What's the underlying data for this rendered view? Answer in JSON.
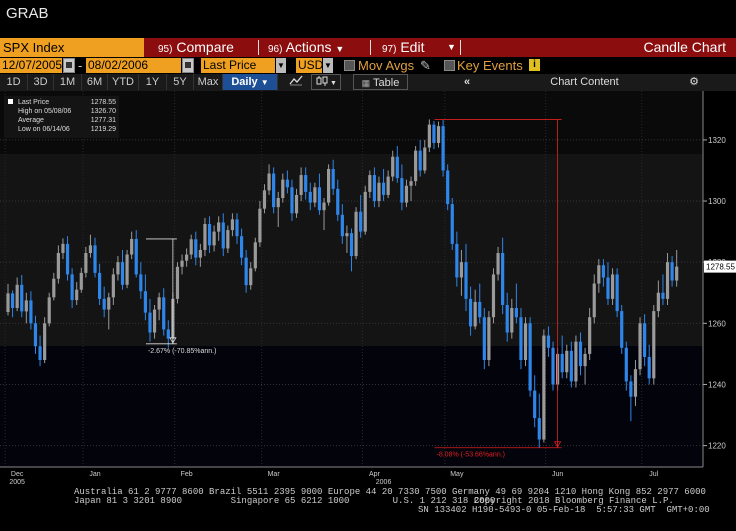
{
  "window": {
    "title": "GRAB"
  },
  "command_bar": {
    "security": "SPX Index",
    "compare": {
      "num": "95)",
      "label": "Compare"
    },
    "actions": {
      "num": "96)",
      "label": "Actions"
    },
    "edit": {
      "num": "97)",
      "label": "Edit"
    },
    "chart_type": "Candle Chart"
  },
  "toolbar": {
    "start_date": "12/07/2005",
    "end_date": "08/02/2006",
    "field": "Last Price",
    "currency": "USD",
    "mov_avgs": "Mov Avgs",
    "key_events": "Key Events",
    "info": "i"
  },
  "period_buttons": [
    "1D",
    "3D",
    "1M",
    "6M",
    "YTD",
    "1Y",
    "5Y",
    "Max"
  ],
  "frequency": "Daily",
  "table_label": "Table",
  "chart_content_label": "Chart Content",
  "legend": {
    "rows": [
      {
        "label": "Last Price",
        "value": "1278.55"
      },
      {
        "label": "High on 05/08/06",
        "value": "1326.70"
      },
      {
        "label": "Average",
        "value": "1277.31"
      },
      {
        "label": "Low on 06/14/06",
        "value": "1219.29"
      }
    ]
  },
  "colors": {
    "up": "#9a9a9a",
    "down": "#2f86ea",
    "accent": "#f0a020",
    "command": "#8b0d0d"
  },
  "chart_data": {
    "type": "candlestick",
    "ylim": [
      1213,
      1336
    ],
    "yticks": [
      1220,
      1240,
      1260,
      1280,
      1300,
      1320
    ],
    "x_month_labels": [
      {
        "label": "Dec",
        "index": 2
      },
      {
        "label": "Jan",
        "index": 19
      },
      {
        "label": "Feb",
        "index": 39
      },
      {
        "label": "Mar",
        "index": 58
      },
      {
        "label": "Apr",
        "index": 80
      },
      {
        "label": "May",
        "index": 98
      },
      {
        "label": "Jun",
        "index": 120
      },
      {
        "label": "Jul",
        "index": 141
      }
    ],
    "x_year_labels": [
      {
        "label": "2005",
        "index": 2
      },
      {
        "label": "2006",
        "index": 82
      }
    ],
    "last_price_label": "1278.55",
    "annotations": [
      {
        "text": "-2.67% (-70.85%ann.)",
        "start_index": 31,
        "end_index": 36,
        "start_value": 1287.6,
        "end_value": 1253.3,
        "color": "#ddd"
      },
      {
        "text": "-8.08% (-53.66%ann.)",
        "start_index": 94,
        "end_index": 120,
        "start_value": 1326.7,
        "end_value": 1219.3,
        "color": "#e02020"
      }
    ],
    "ohlc": [
      [
        1263.7,
        1272.9,
        1262.6,
        1269.8
      ],
      [
        1269.8,
        1270.8,
        1262.0,
        1265.0
      ],
      [
        1265.0,
        1275.0,
        1264.0,
        1272.6
      ],
      [
        1272.6,
        1275.8,
        1262.0,
        1263.9
      ],
      [
        1263.9,
        1270.0,
        1260.0,
        1267.5
      ],
      [
        1267.5,
        1270.5,
        1258.0,
        1260.0
      ],
      [
        1260.0,
        1262.5,
        1250.0,
        1252.5
      ],
      [
        1252.5,
        1256.0,
        1246.0,
        1248.0
      ],
      [
        1248.0,
        1262.0,
        1247.0,
        1260.0
      ],
      [
        1260.0,
        1270.0,
        1259.0,
        1268.5
      ],
      [
        1268.5,
        1276.5,
        1267.5,
        1274.6
      ],
      [
        1274.6,
        1285.5,
        1273.0,
        1283.0
      ],
      [
        1283.0,
        1287.8,
        1281.0,
        1286.0
      ],
      [
        1286.0,
        1288.5,
        1274.0,
        1276.0
      ],
      [
        1276.0,
        1278.0,
        1265.0,
        1267.6
      ],
      [
        1267.6,
        1273.5,
        1266.0,
        1271.0
      ],
      [
        1271.0,
        1278.2,
        1270.0,
        1276.5
      ],
      [
        1276.5,
        1285.0,
        1275.0,
        1283.0
      ],
      [
        1283.0,
        1289.0,
        1281.5,
        1285.5
      ],
      [
        1285.5,
        1288.0,
        1275.0,
        1276.5
      ],
      [
        1276.5,
        1279.5,
        1266.0,
        1268.0
      ],
      [
        1268.0,
        1272.0,
        1262.0,
        1264.5
      ],
      [
        1264.5,
        1270.0,
        1258.0,
        1268.5
      ],
      [
        1268.5,
        1278.0,
        1266.0,
        1276.0
      ],
      [
        1276.0,
        1282.0,
        1274.0,
        1280.0
      ],
      [
        1280.0,
        1284.0,
        1271.0,
        1272.6
      ],
      [
        1272.6,
        1284.0,
        1271.5,
        1282.5
      ],
      [
        1282.5,
        1290.0,
        1281.0,
        1287.6
      ],
      [
        1287.6,
        1290.5,
        1275.0,
        1276.0
      ],
      [
        1276.0,
        1280.0,
        1268.0,
        1270.5
      ],
      [
        1270.5,
        1276.0,
        1261.0,
        1263.5
      ],
      [
        1263.5,
        1268.0,
        1254.0,
        1257.0
      ],
      [
        1257.0,
        1266.0,
        1255.0,
        1264.5
      ],
      [
        1264.5,
        1270.0,
        1261.0,
        1268.5
      ],
      [
        1268.5,
        1271.5,
        1256.0,
        1258.0
      ],
      [
        1258.0,
        1261.0,
        1252.0,
        1255.0
      ],
      [
        1255.0,
        1270.0,
        1253.5,
        1268.0
      ],
      [
        1268.0,
        1280.0,
        1266.5,
        1278.5
      ],
      [
        1278.5,
        1282.5,
        1276.0,
        1280.5
      ],
      [
        1280.5,
        1284.5,
        1278.5,
        1282.5
      ],
      [
        1282.5,
        1289.0,
        1281.0,
        1287.5
      ],
      [
        1287.5,
        1290.0,
        1279.0,
        1281.5
      ],
      [
        1281.5,
        1286.0,
        1278.5,
        1284.0
      ],
      [
        1284.0,
        1294.5,
        1282.0,
        1292.5
      ],
      [
        1292.5,
        1295.0,
        1283.0,
        1285.5
      ],
      [
        1285.5,
        1292.0,
        1283.5,
        1290.0
      ],
      [
        1290.0,
        1295.0,
        1287.0,
        1293.0
      ],
      [
        1293.0,
        1296.0,
        1282.0,
        1284.5
      ],
      [
        1284.5,
        1292.0,
        1283.0,
        1290.5
      ],
      [
        1290.5,
        1296.0,
        1288.5,
        1294.0
      ],
      [
        1294.0,
        1296.0,
        1286.0,
        1288.5
      ],
      [
        1288.5,
        1291.0,
        1279.0,
        1281.5
      ],
      [
        1281.5,
        1284.0,
        1270.0,
        1272.5
      ],
      [
        1272.5,
        1280.0,
        1271.0,
        1278.0
      ],
      [
        1278.0,
        1288.0,
        1277.0,
        1286.5
      ],
      [
        1286.5,
        1300.0,
        1285.0,
        1297.5
      ],
      [
        1297.5,
        1305.5,
        1296.0,
        1303.5
      ],
      [
        1303.5,
        1312.0,
        1302.0,
        1309.0
      ],
      [
        1309.0,
        1311.0,
        1296.0,
        1298.0
      ],
      [
        1298.0,
        1303.0,
        1291.5,
        1301.0
      ],
      [
        1301.0,
        1309.0,
        1299.5,
        1307.0
      ],
      [
        1307.0,
        1310.0,
        1302.5,
        1304.5
      ],
      [
        1304.5,
        1307.0,
        1293.5,
        1296.0
      ],
      [
        1296.0,
        1304.0,
        1294.5,
        1302.0
      ],
      [
        1302.0,
        1311.0,
        1300.0,
        1308.5
      ],
      [
        1308.5,
        1311.0,
        1300.5,
        1303.0
      ],
      [
        1303.0,
        1306.0,
        1297.0,
        1299.5
      ],
      [
        1299.5,
        1306.0,
        1298.0,
        1304.5
      ],
      [
        1304.5,
        1309.0,
        1295.5,
        1297.0
      ],
      [
        1297.0,
        1301.0,
        1290.5,
        1299.5
      ],
      [
        1299.5,
        1312.0,
        1298.5,
        1310.5
      ],
      [
        1310.5,
        1313.5,
        1302.0,
        1304.0
      ],
      [
        1304.0,
        1307.0,
        1293.5,
        1295.5
      ],
      [
        1295.5,
        1299.0,
        1286.0,
        1288.5
      ],
      [
        1288.5,
        1292.0,
        1283.0,
        1289.5
      ],
      [
        1289.5,
        1291.0,
        1277.0,
        1282.0
      ],
      [
        1282.0,
        1298.0,
        1281.0,
        1296.5
      ],
      [
        1296.5,
        1302.0,
        1288.0,
        1290.0
      ],
      [
        1290.0,
        1305.0,
        1289.0,
        1303.0
      ],
      [
        1303.0,
        1310.0,
        1301.0,
        1308.5
      ],
      [
        1308.5,
        1311.0,
        1298.0,
        1300.0
      ],
      [
        1300.0,
        1308.0,
        1298.0,
        1306.0
      ],
      [
        1306.0,
        1310.5,
        1300.0,
        1302.0
      ],
      [
        1302.0,
        1310.0,
        1301.0,
        1308.0
      ],
      [
        1308.0,
        1316.5,
        1306.5,
        1314.5
      ],
      [
        1314.5,
        1318.0,
        1306.0,
        1307.5
      ],
      [
        1307.5,
        1312.0,
        1297.0,
        1299.5
      ],
      [
        1299.5,
        1307.0,
        1298.0,
        1305.0
      ],
      [
        1305.0,
        1308.0,
        1300.0,
        1306.5
      ],
      [
        1306.5,
        1318.0,
        1305.0,
        1316.5
      ],
      [
        1316.5,
        1320.0,
        1308.0,
        1310.0
      ],
      [
        1310.0,
        1320.0,
        1309.0,
        1317.5
      ],
      [
        1317.5,
        1326.7,
        1316.0,
        1325.0
      ],
      [
        1325.0,
        1326.2,
        1317.0,
        1319.0
      ],
      [
        1319.0,
        1326.0,
        1317.5,
        1324.5
      ],
      [
        1324.5,
        1326.5,
        1308.0,
        1310.0
      ],
      [
        1310.0,
        1312.0,
        1297.0,
        1299.0
      ],
      [
        1299.0,
        1301.0,
        1284.0,
        1286.0
      ],
      [
        1286.0,
        1290.0,
        1272.0,
        1275.0
      ],
      [
        1275.0,
        1284.0,
        1269.0,
        1280.0
      ],
      [
        1280.0,
        1286.0,
        1264.0,
        1268.0
      ],
      [
        1268.0,
        1272.0,
        1256.0,
        1259.0
      ],
      [
        1259.0,
        1271.0,
        1258.0,
        1267.0
      ],
      [
        1267.0,
        1273.0,
        1260.0,
        1262.0
      ],
      [
        1262.0,
        1265.0,
        1245.0,
        1248.0
      ],
      [
        1248.0,
        1264.0,
        1246.0,
        1262.0
      ],
      [
        1262.0,
        1278.0,
        1260.0,
        1276.0
      ],
      [
        1276.0,
        1285.0,
        1274.0,
        1283.0
      ],
      [
        1283.0,
        1288.0,
        1263.0,
        1266.0
      ],
      [
        1266.0,
        1270.0,
        1254.0,
        1257.0
      ],
      [
        1257.0,
        1268.0,
        1255.0,
        1265.0
      ],
      [
        1265.0,
        1273.0,
        1260.0,
        1262.0
      ],
      [
        1262.0,
        1265.0,
        1245.0,
        1248.0
      ],
      [
        1248.0,
        1262.0,
        1246.0,
        1260.0
      ],
      [
        1260.0,
        1262.0,
        1236.0,
        1238.0
      ],
      [
        1238.0,
        1243.0,
        1226.0,
        1229.0
      ],
      [
        1229.0,
        1237.0,
        1219.3,
        1222.0
      ],
      [
        1222.0,
        1258.0,
        1221.0,
        1256.0
      ],
      [
        1256.0,
        1259.0,
        1249.0,
        1252.0
      ],
      [
        1252.0,
        1254.0,
        1238.0,
        1240.0
      ],
      [
        1240.0,
        1252.0,
        1238.0,
        1250.0
      ],
      [
        1250.0,
        1256.0,
        1242.0,
        1244.0
      ],
      [
        1244.0,
        1253.0,
        1242.0,
        1251.0
      ],
      [
        1251.0,
        1254.0,
        1239.0,
        1241.0
      ],
      [
        1241.0,
        1256.0,
        1239.0,
        1254.0
      ],
      [
        1254.0,
        1257.0,
        1243.0,
        1246.0
      ],
      [
        1246.0,
        1252.0,
        1240.0,
        1250.0
      ],
      [
        1250.0,
        1265.0,
        1248.0,
        1262.0
      ],
      [
        1262.0,
        1276.0,
        1260.0,
        1273.0
      ],
      [
        1273.0,
        1281.0,
        1270.0,
        1279.0
      ],
      [
        1279.0,
        1281.0,
        1272.0,
        1275.0
      ],
      [
        1275.0,
        1280.0,
        1266.0,
        1268.0
      ],
      [
        1268.0,
        1278.0,
        1266.0,
        1276.0
      ],
      [
        1276.0,
        1278.0,
        1262.0,
        1264.0
      ],
      [
        1264.0,
        1266.0,
        1250.0,
        1252.0
      ],
      [
        1252.0,
        1254.0,
        1238.0,
        1241.0
      ],
      [
        1241.0,
        1243.0,
        1228.0,
        1236.0
      ],
      [
        1236.0,
        1248.0,
        1233.0,
        1245.0
      ],
      [
        1245.0,
        1262.0,
        1243.0,
        1260.0
      ],
      [
        1260.0,
        1263.0,
        1246.0,
        1249.0
      ],
      [
        1249.0,
        1253.0,
        1240.0,
        1242.0
      ],
      [
        1242.0,
        1266.0,
        1240.0,
        1264.0
      ],
      [
        1264.0,
        1274.0,
        1262.0,
        1270.0
      ],
      [
        1270.0,
        1276.0,
        1266.0,
        1268.0
      ],
      [
        1268.0,
        1283.0,
        1266.0,
        1280.0
      ],
      [
        1280.0,
        1282.0,
        1272.0,
        1274.0
      ],
      [
        1274.0,
        1284.0,
        1272.0,
        1278.55
      ]
    ]
  },
  "footer": {
    "line1": "Australia 61 2 9777 8600 Brazil 5511 2395 9000 Europe 44 20 7330 7500 Germany 49 69 9204 1210 Hong Kong 852 2977 6000",
    "line2a": "Japan 81 3 3201 8900         Singapore 65 6212 1000        U.S. 1 212 318 2000",
    "line2b": "Copyright 2018 Bloomberg Finance L.P.",
    "line3": "SN 133402 H190-5493-0 05-Feb-18  5:57:33 GMT  GMT+0:00"
  }
}
